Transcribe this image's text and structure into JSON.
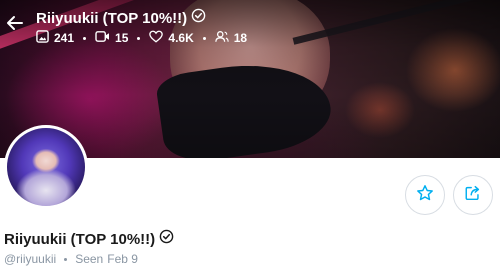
{
  "header": {
    "title": "Riiyuukii (TOP 10%!!)",
    "stats": {
      "photos": "241",
      "videos": "15",
      "likes": "4.6K",
      "fans": "18"
    }
  },
  "profile": {
    "name": "Riiyuukii (TOP 10%!!)",
    "handle": "@riiyuukii",
    "seen": "Seen",
    "seen_date": "Feb 9"
  },
  "icons": {
    "back": "arrow-left-icon",
    "verified": "verified-badge-icon",
    "photos": "image-icon",
    "videos": "video-icon",
    "likes": "heart-icon",
    "fans": "users-icon",
    "favorite": "star-icon",
    "share": "share-icon"
  },
  "colors": {
    "accent": "#00aff0",
    "muted_text": "#8a96a3",
    "name_text": "#1a1a1a"
  }
}
